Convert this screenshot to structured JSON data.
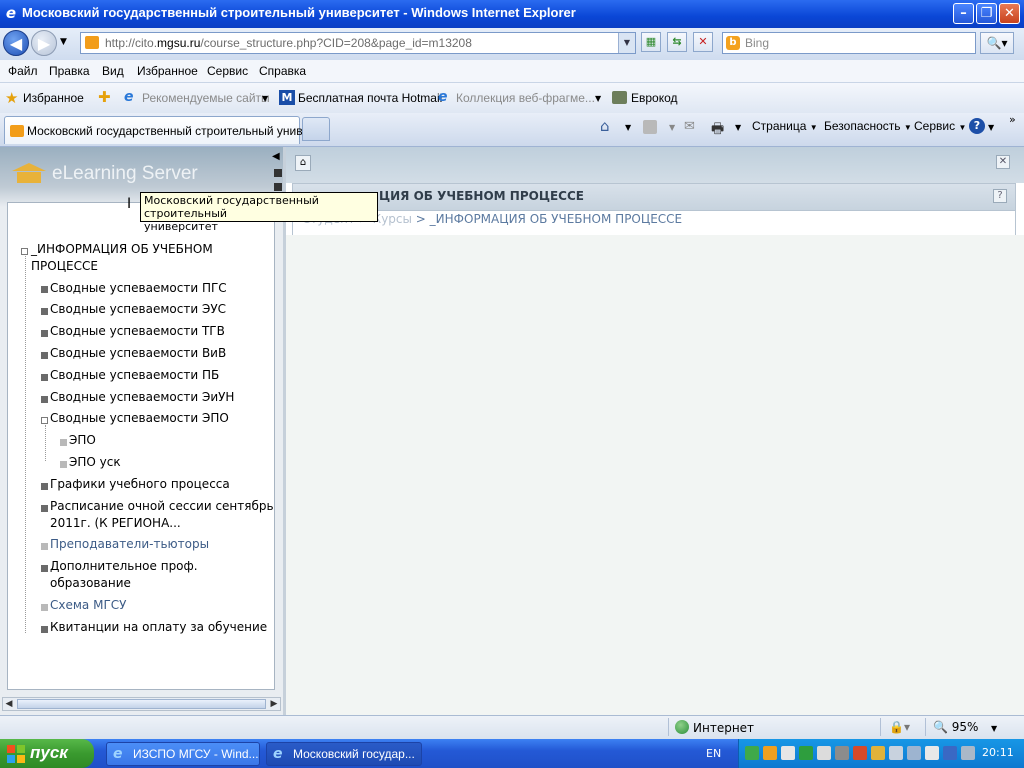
{
  "window": {
    "title": "Московский государственный строительный университет - Windows Internet Explorer"
  },
  "address": {
    "url_prefix": "http://cito.",
    "url_domain": "mgsu.ru",
    "url_path": "/course_structure.php?CID=208&page_id=m13208"
  },
  "search": {
    "placeholder": "Bing"
  },
  "menu": [
    "Файл",
    "Правка",
    "Вид",
    "Избранное",
    "Сервис",
    "Справка"
  ],
  "favorites": {
    "label": "Избранное",
    "items": [
      "Рекомендуемые сайты",
      "Бесплатная почта Hotmail",
      "Коллекция веб-фрагме...",
      "Еврокод"
    ]
  },
  "tab": {
    "label": "Московский государственный строительный унив..."
  },
  "commands": {
    "page": "Страница",
    "security": "Безопасность",
    "tools": "Сервис"
  },
  "sidebar": {
    "logo": "eLearning Server",
    "tree": {
      "root_line1": "_ИНФОРМАЦИЯ ОБ УЧЕБНОМ",
      "root_line2": "ПРОЦЕССЕ",
      "items": [
        "Сводные успеваемости ПГС",
        "Сводные успеваемости ЭУС",
        "Сводные успеваемости ТГВ",
        "Сводные успеваемости ВиВ",
        "Сводные успеваемости ПБ",
        "Сводные успеваемости ЭиУН",
        "Сводные успеваемости ЭПО"
      ],
      "sub_items": [
        "ЭПО",
        "ЭПО уск"
      ],
      "items2": [
        "Графики учебного процесса"
      ],
      "schedule_line1": "Расписание очной сессии сентябрь",
      "schedule_line2": "2011г. (К РЕГИОНА...",
      "tutors": "Преподаватели-тьюторы",
      "extra_line1": "Дополнительное проф.",
      "extra_line2": "образование",
      "scheme": "Схема МГСУ",
      "receipts": "Квитанции на оплату за обучение"
    }
  },
  "main": {
    "header_title": "ЦИЯ ОБ УЧЕБНОМ ПРОЦЕССЕ",
    "breadcrumb_hidden": "Студент > Курсы",
    "breadcrumb_sep": " > ",
    "breadcrumb_current": "_ИНФОРМАЦИЯ ОБ УЧЕБНОМ ПРОЦЕССЕ"
  },
  "tooltip": {
    "line1": "Московский государственный строительный",
    "line2": "университет"
  },
  "status": {
    "zone": "Интернет",
    "zoom": "95%"
  },
  "taskbar": {
    "start": "пуск",
    "buttons": [
      "ИЗСПО МГСУ - Wind...",
      "Московский государ..."
    ],
    "lang": "EN",
    "time": "20:11"
  }
}
